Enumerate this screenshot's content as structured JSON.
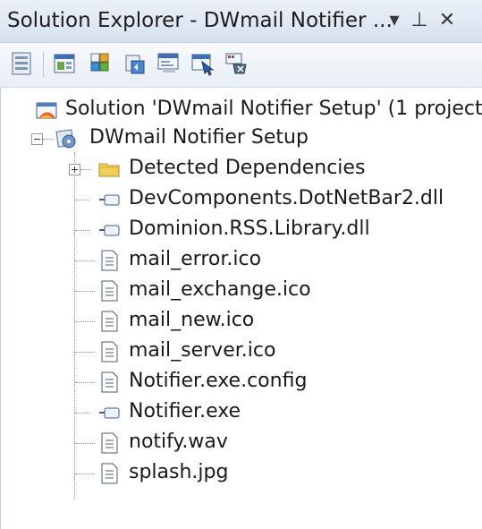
{
  "panel": {
    "title": "Solution Explorer - DWmail Notifier ...",
    "dropdown_glyph": "▾",
    "pin_glyph": "⊥",
    "close_glyph": "✕"
  },
  "toolbar": {
    "buttons": [
      {
        "icon": "properties-icon"
      },
      {
        "icon": "file-system-editor-icon"
      },
      {
        "icon": "registry-editor-icon"
      },
      {
        "icon": "file-types-editor-icon"
      },
      {
        "icon": "user-interface-editor-icon"
      },
      {
        "icon": "custom-actions-editor-icon"
      },
      {
        "icon": "launch-conditions-editor-icon"
      }
    ]
  },
  "tree": {
    "solution": "Solution 'DWmail Notifier Setup' (1 project)",
    "project": "DWmail Notifier Setup",
    "items": [
      {
        "label": "Detected Dependencies",
        "icon": "folder-icon"
      },
      {
        "label": "DevComponents.DotNetBar2.dll",
        "icon": "assembly-icon"
      },
      {
        "label": "Dominion.RSS.Library.dll",
        "icon": "assembly-icon"
      },
      {
        "label": "mail_error.ico",
        "icon": "file-icon"
      },
      {
        "label": "mail_exchange.ico",
        "icon": "file-icon"
      },
      {
        "label": "mail_new.ico",
        "icon": "file-icon"
      },
      {
        "label": "mail_server.ico",
        "icon": "file-icon"
      },
      {
        "label": "Notifier.exe.config",
        "icon": "file-icon"
      },
      {
        "label": "Notifier.exe",
        "icon": "assembly-icon"
      },
      {
        "label": "notify.wav",
        "icon": "file-icon"
      },
      {
        "label": "splash.jpg",
        "icon": "file-icon"
      }
    ]
  }
}
